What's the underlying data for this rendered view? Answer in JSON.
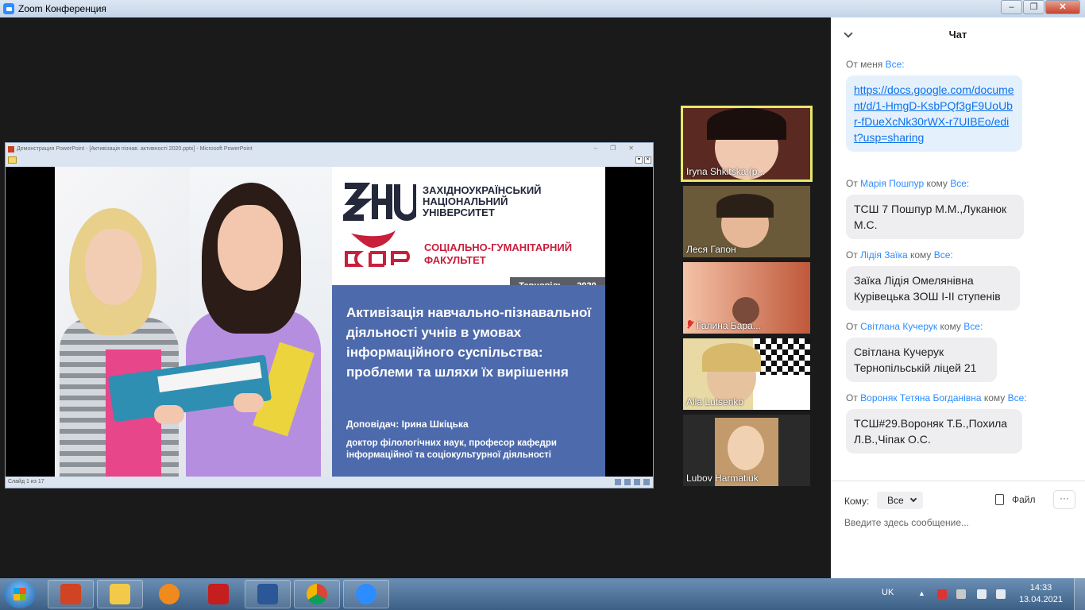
{
  "window": {
    "title": "Zoom Конференция"
  },
  "ppt": {
    "title": "Демонстрация PowerPoint - [Активізація пізнав. активності 2020.pptx] - Microsoft PowerPoint",
    "status": "Слайд 1 из 17"
  },
  "slide": {
    "uni_name": "ЗАХІДНОУКРАЇНСЬКИЙ НАЦІОНАЛЬНИЙ УНІВЕРСИТЕТ",
    "faculty": "СОЦІАЛЬНО-ГУМАНІТАРНИЙ ФАКУЛЬТЕТ",
    "city": "Тернопіль — 2020",
    "title": "Активізація навчально-пізнавальної діяльності учнів в умовах інформаційного суспільства: проблеми та шляхи їх вирішення",
    "reporter": "Доповідач: Ірина Шкіцька",
    "degree": "доктор філологічних наук, професор кафедри інформаційної та соціокультурної діяльності"
  },
  "participants": [
    {
      "name": "Iryna Shkitska (р...",
      "muted": false,
      "active": true,
      "bg": "#5a2a22"
    },
    {
      "name": "Леся Гапон",
      "muted": false,
      "active": false,
      "bg": "#6b5a3a"
    },
    {
      "name": "Галина Бара...",
      "muted": true,
      "active": false,
      "bg": "#c9704a"
    },
    {
      "name": "Alla Lutsenko",
      "muted": false,
      "active": false,
      "bg": "#c9b680"
    },
    {
      "name": "Lubov Harmatiuk",
      "muted": false,
      "active": false,
      "bg": "#2a2a2a"
    }
  ],
  "chat": {
    "title": "Чат",
    "messages": [
      {
        "from_prefix": "От ",
        "from": "меня",
        "to_prefix": " ",
        "to": "Все:",
        "text": "https://docs.google.com/document/d/1-HmgD-KsbPQf3gF9UoUbr-fDueXcNk30rWX-r7UIBEo/edit?usp=sharing",
        "link": true
      },
      {
        "from_prefix": "От ",
        "from": "Марія Пошпур",
        "to_prefix": " кому ",
        "to": "Все:",
        "text": "ТСШ 7 Пошпур М.М.,Луканюк М.С.",
        "link": false
      },
      {
        "from_prefix": "От ",
        "from": "Лідія Заїка",
        "to_prefix": " кому ",
        "to": "Все:",
        "text": "Заїка Лідія Омелянівна Курівецька ЗОШ І-ІІ ступенів",
        "link": false
      },
      {
        "from_prefix": "От ",
        "from": "Світлана Кучерук",
        "to_prefix": " кому ",
        "to": "Все:",
        "text": "Світлана Кучерук Тернопільській ліцей 21",
        "link": false
      },
      {
        "from_prefix": "От ",
        "from": "Вороняк Тетяна Богданівна",
        "to_prefix": " кому ",
        "to": "Все:",
        "text": "ТСШ#29.Вороняк Т.Б.,Похила Л.В.,Чіпак О.С.",
        "link": false
      }
    ],
    "to_label": "Кому:",
    "to_value": "Все",
    "file_label": "Файл",
    "more_label": "···",
    "input_placeholder": "Введите здесь сообщение..."
  },
  "taskbar": {
    "apps": [
      "powerpoint",
      "explorer",
      "media-player",
      "acrobat",
      "word",
      "chrome",
      "zoom"
    ],
    "lang": "UK",
    "time": "14:33",
    "date": "13.04.2021"
  }
}
